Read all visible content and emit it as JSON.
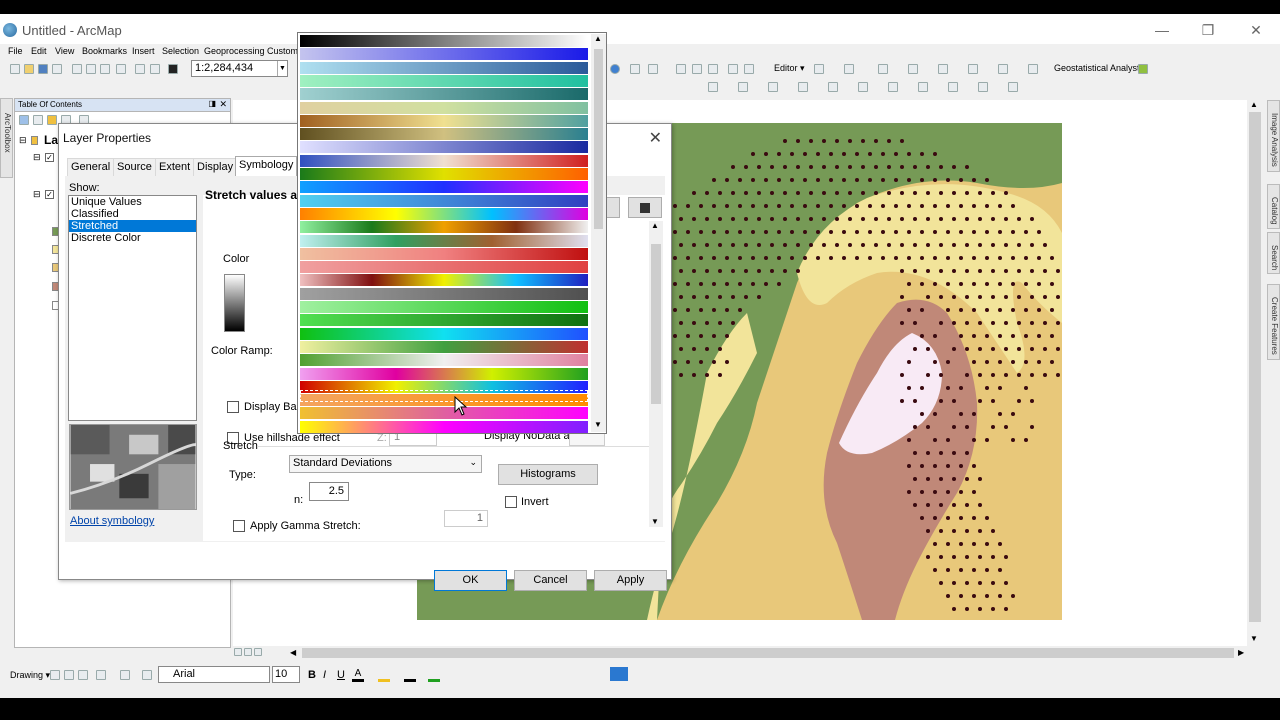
{
  "window": {
    "title": "Untitled - ArcMap"
  },
  "menu": [
    "File",
    "Edit",
    "View",
    "Bookmarks",
    "Insert",
    "Selection",
    "Geoprocessing",
    "Customi"
  ],
  "toolbar": {
    "scale": "1:2,284,434",
    "editor": "Editor ▾",
    "geostat": "Geostatistical Analyst ▾"
  },
  "toc": {
    "title": "Table Of Contents",
    "layer_prefix": "La"
  },
  "side_tabs": {
    "left": "ArcToolbox",
    "right": [
      "Image Analysis",
      "Catalog",
      "Search",
      "Create Features"
    ]
  },
  "draw": {
    "drawing_label": "Drawing ▾",
    "font": "Arial",
    "font_size": "10",
    "bold": "B",
    "italic": "I",
    "underline": "U"
  },
  "dialog": {
    "title": "Layer Properties",
    "tabs": [
      "General",
      "Source",
      "Extent",
      "Display",
      "Symbology"
    ],
    "active_tab": "Symbology",
    "show_label": "Show:",
    "show_items": [
      "Unique Values",
      "Classified",
      "Stretched",
      "Discrete Color"
    ],
    "selected_show": "Stretched",
    "about_link": "About symbology",
    "header": "Stretch values alo",
    "color_label": "Color",
    "color_ramp_label": "Color Ramp:",
    "display_background": "Display Bac",
    "use_hillshade": "Use hillshade effect",
    "hillshade_z_label": "Z:",
    "hillshade_z_value": "1",
    "display_nodata": "Display NoData as",
    "stretch_label": "Stretch",
    "type_label": "Type:",
    "type_value": "Standard Deviations",
    "n_label": "n:",
    "n_value": "2.5",
    "histograms": "Histograms",
    "invert": "Invert",
    "gamma_label": "Apply Gamma Stretch:",
    "gamma_value": "1",
    "ok": "OK",
    "cancel": "Cancel",
    "apply": "Apply"
  },
  "ramps": [
    [
      "#000000",
      "#ffffff"
    ],
    [
      "#c4c4ee",
      "#1a1ae8"
    ],
    [
      "#b0e0f0",
      "#2a5a9a"
    ],
    [
      "#a0f0c0",
      "#20c0a0"
    ],
    [
      "#a0d0d0",
      "#1a6a6a"
    ],
    [
      "#e0d0a0",
      "#d0e0a0",
      "#80c0a0"
    ],
    [
      "#a06020",
      "#f0e090",
      "#50a0a0"
    ],
    [
      "#605020",
      "#d0c080",
      "#2a8090"
    ],
    [
      "#e0e0ff",
      "#1a2aa0"
    ],
    [
      "#3050c0",
      "#f0e0d0",
      "#d02020"
    ],
    [
      "#1a7a1a",
      "#e0e000",
      "#ff6000"
    ],
    [
      "#10a0ff",
      "#2030ff",
      "#ff00ff"
    ],
    [
      "#50d0f0",
      "#3040c0"
    ],
    [
      "#ff8000",
      "#ffff00",
      "#00c0ff",
      "#e000e0"
    ],
    [
      "#90f0a0",
      "#1a7a1a",
      "#f0a000",
      "#803010",
      "#f0f0f0"
    ],
    [
      "#c0f0f0",
      "#30a060",
      "#a06030",
      "#e0e0f0"
    ],
    [
      "#f0c0a0",
      "#f08080",
      "#c01010"
    ],
    [
      "#f0a0a0",
      "#e04040"
    ],
    [
      "#f0c0c0",
      "#801010",
      "#f0f000",
      "#10c0ff",
      "#2020c0"
    ],
    [
      "#a0a0a0",
      "#505050"
    ],
    [
      "#a0f0a0",
      "#10c010"
    ],
    [
      "#50e050",
      "#107010"
    ],
    [
      "#10c010",
      "#10e0f0",
      "#2050ff"
    ],
    [
      "#f0f0a0",
      "#40a040",
      "#c03030"
    ],
    [
      "#50a030",
      "#f0f0f0",
      "#e080a0"
    ],
    [
      "#f0a0f0",
      "#e000a0",
      "#d0f000",
      "#20a020"
    ],
    [
      "#d00000",
      "#f0f000",
      "#10c0e0",
      "#2020ff"
    ],
    [
      "#f4a460",
      "#ff8c00"
    ],
    [
      "#f0c030",
      "#e060a0",
      "#ff00ff"
    ],
    [
      "#ffff00",
      "#ff00ff",
      "#8020ff"
    ]
  ],
  "colors": {
    "map_green": "#769a56",
    "map_yellow": "#f2e49a",
    "map_tan": "#e8c87a",
    "map_brown": "#c08878",
    "map_pink": "#f8eaf5",
    "dot": "#3a0a10"
  }
}
